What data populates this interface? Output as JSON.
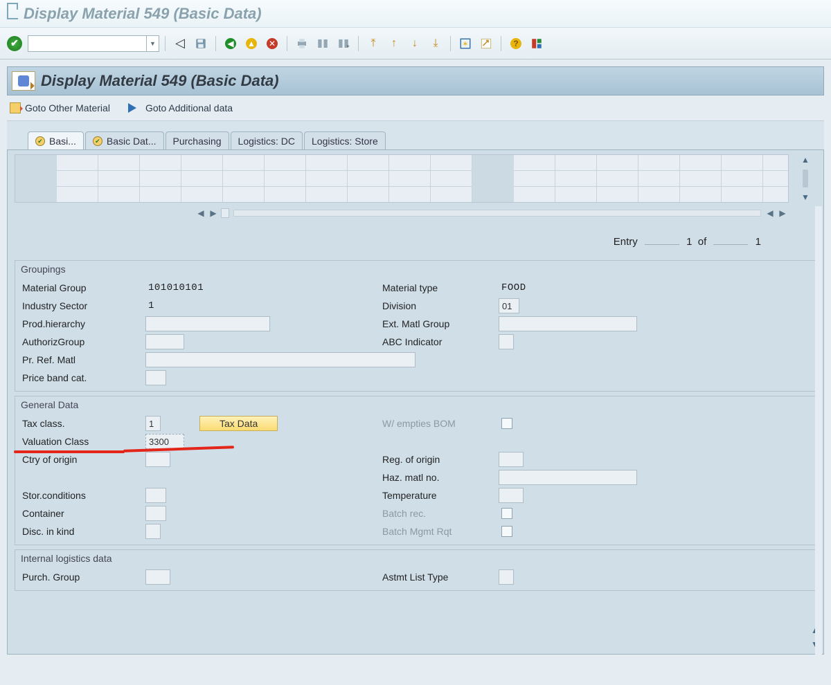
{
  "window_title": "Display Material 549 (Basic Data)",
  "panel_title": "Display Material 549 (Basic Data)",
  "links": {
    "goto_other": "Goto Other Material",
    "goto_additional": "Goto Additional data"
  },
  "tabs": [
    {
      "label": "Basi...",
      "active": true,
      "checked": true
    },
    {
      "label": "Basic Dat...",
      "active": false,
      "checked": true
    },
    {
      "label": "Purchasing",
      "active": false,
      "checked": false
    },
    {
      "label": "Logistics: DC",
      "active": false,
      "checked": false
    },
    {
      "label": "Logistics: Store",
      "active": false,
      "checked": false
    }
  ],
  "entry": {
    "label": "Entry",
    "current": "1",
    "of_label": "of",
    "total": "1"
  },
  "sections": {
    "groupings": {
      "title": "Groupings",
      "material_group": {
        "label": "Material Group",
        "value": "101010101"
      },
      "material_type": {
        "label": "Material type",
        "value": "FOOD"
      },
      "industry_sector": {
        "label": "Industry Sector",
        "value": "1"
      },
      "division": {
        "label": "Division",
        "value": "01"
      },
      "prod_hierarchy": {
        "label": "Prod.hierarchy",
        "value": ""
      },
      "ext_matl_group": {
        "label": "Ext. Matl Group",
        "value": ""
      },
      "authoriz_group": {
        "label": "AuthorizGroup",
        "value": ""
      },
      "abc_indicator": {
        "label": "ABC Indicator",
        "value": ""
      },
      "pr_ref_matl": {
        "label": "Pr. Ref. Matl",
        "value": ""
      },
      "price_band_cat": {
        "label": "Price band cat.",
        "value": ""
      }
    },
    "general": {
      "title": "General Data",
      "tax_class": {
        "label": "Tax class.",
        "value": "1"
      },
      "tax_data_btn": "Tax Data",
      "w_empties_bom": {
        "label": "W/ empties BOM"
      },
      "valuation_class": {
        "label": "Valuation Class",
        "value": "3300"
      },
      "ctry_of_origin": {
        "label": "Ctry of origin",
        "value": ""
      },
      "reg_of_origin": {
        "label": "Reg. of origin",
        "value": ""
      },
      "haz_matl_no": {
        "label": "Haz. matl no.",
        "value": ""
      },
      "stor_conditions": {
        "label": "Stor.conditions",
        "value": ""
      },
      "temperature": {
        "label": "Temperature",
        "value": ""
      },
      "container": {
        "label": "Container",
        "value": ""
      },
      "batch_rec": {
        "label": "Batch rec."
      },
      "disc_in_kind": {
        "label": "Disc. in kind",
        "value": ""
      },
      "batch_mgmt_rqt": {
        "label": "Batch Mgmt Rqt"
      }
    },
    "internal": {
      "title": "Internal logistics data",
      "purch_group": {
        "label": "Purch. Group",
        "value": ""
      },
      "astmt_list_type": {
        "label": "Astmt List Type",
        "value": ""
      }
    }
  }
}
